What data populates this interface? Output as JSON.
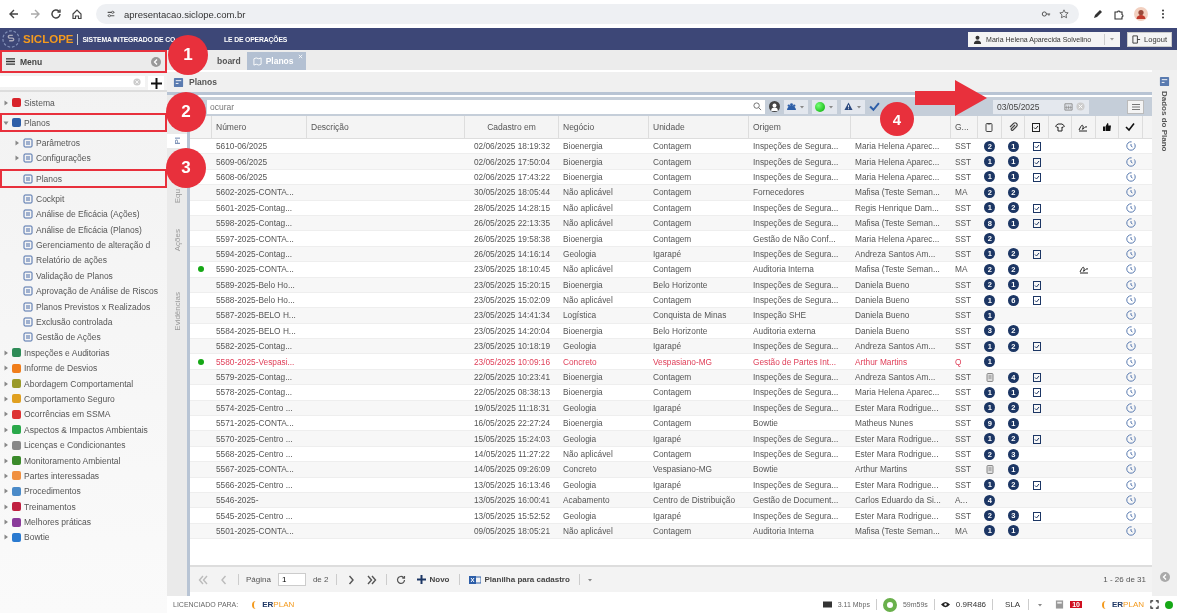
{
  "browser": {
    "url": "apresentacao.siclope.com.br"
  },
  "header": {
    "logo": "SICLOPE",
    "subtitle_a": "SISTEMA INTEGRADO DE CO",
    "subtitle_b": "LE DE OPERAÇÕES",
    "user": "Maria Helena Aparecida Solvelino",
    "logout": "Logout"
  },
  "menu": {
    "title": "Menu",
    "boxed": true,
    "items": [
      {
        "label": "Sistema",
        "collapsed": true,
        "boxed": false
      },
      {
        "label": "Planos",
        "collapsed": false,
        "boxed": true,
        "children": [
          {
            "label": "Parâmetros",
            "collapsed": true,
            "boxed": false
          },
          {
            "label": "Configurações",
            "collapsed": true,
            "boxed": false
          },
          {
            "label": "Planos",
            "boxed": true
          },
          {
            "label": "Cockpit",
            "boxed": false
          },
          {
            "label": "Análise de Eficácia (Ações)",
            "boxed": false
          },
          {
            "label": "Análise de Eficácia (Planos)",
            "boxed": false
          },
          {
            "label": "Gerenciamento de alteração d",
            "boxed": false
          },
          {
            "label": "Relatório de ações",
            "boxed": false
          },
          {
            "label": "Validação de Planos",
            "boxed": false
          },
          {
            "label": "Aprovação de Análise de Riscos",
            "boxed": false
          },
          {
            "label": "Planos Previstos x Realizados",
            "boxed": false
          },
          {
            "label": "Exclusão controlada",
            "boxed": false
          },
          {
            "label": "Gestão de Ações",
            "boxed": false
          }
        ]
      },
      {
        "label": "Inspeções e Auditorias",
        "collapsed": true,
        "boxed": false
      },
      {
        "label": "Informe de Desvios",
        "collapsed": true,
        "boxed": false
      },
      {
        "label": "Abordagem Comportamental",
        "collapsed": true,
        "boxed": false
      },
      {
        "label": "Comportamento Seguro",
        "collapsed": true,
        "boxed": false
      },
      {
        "label": "Ocorrências em SSMA",
        "collapsed": true,
        "boxed": false
      },
      {
        "label": "Aspectos & Impactos Ambientais",
        "collapsed": true,
        "boxed": false
      },
      {
        "label": "Licenças e Condicionantes",
        "collapsed": true,
        "boxed": false
      },
      {
        "label": "Monitoramento Ambiental",
        "collapsed": true,
        "boxed": false
      },
      {
        "label": "Partes interessadas",
        "collapsed": true,
        "boxed": false
      },
      {
        "label": "Procedimentos",
        "collapsed": true,
        "boxed": false
      },
      {
        "label": "Treinamentos",
        "collapsed": true,
        "boxed": false
      },
      {
        "label": "Melhores práticas",
        "collapsed": true,
        "boxed": false
      },
      {
        "label": "Bowtie",
        "collapsed": true,
        "boxed": false
      }
    ]
  },
  "tabs": [
    {
      "label": "board",
      "selected": false
    },
    {
      "label": "Planos",
      "selected": true
    }
  ],
  "panel_title": "Planos",
  "side_tabs": [
    {
      "label": "Pl",
      "selected": true
    },
    {
      "label": "Equ",
      "selected": false
    },
    {
      "label": "Ações",
      "selected": false
    },
    {
      "label": "Evidências",
      "selected": false
    }
  ],
  "toolbar": {
    "search_placeholder": "ocurar",
    "date": "03/05/2025"
  },
  "table": {
    "columns": [
      "Número",
      "Descrição",
      "Cadastro em",
      "Negócio",
      "Unidade",
      "Origem",
      "G..."
    ],
    "rows": [
      {
        "number": "5610-06/2025",
        "date": "02/06/2025 18:19:32",
        "business": "Bioenergia",
        "unit": "Contagem",
        "origin": "Inspeções de Segura...",
        "owner": "Maria Helena Aparec...",
        "g": "SST",
        "doc": "2",
        "att": "1",
        "checklist": true,
        "signed": false,
        "status_dot": false,
        "highlight": false
      },
      {
        "number": "5609-06/2025",
        "date": "02/06/2025 17:50:04",
        "business": "Bioenergia",
        "unit": "Contagem",
        "origin": "Inspeções de Segura...",
        "owner": "Maria Helena Aparec...",
        "g": "SST",
        "doc": "1",
        "att": "1",
        "checklist": true,
        "signed": false,
        "status_dot": false,
        "highlight": false
      },
      {
        "number": "5608-06/2025",
        "date": "02/06/2025 17:43:22",
        "business": "Bioenergia",
        "unit": "Contagem",
        "origin": "Inspeções de Segura...",
        "owner": "Maria Helena Aparec...",
        "g": "SST",
        "doc": "1",
        "att": "1",
        "checklist": true,
        "signed": false,
        "status_dot": false,
        "highlight": false
      },
      {
        "number": "5602-2025-CONTA...",
        "date": "30/05/2025 18:05:44",
        "business": "Não aplicável",
        "unit": "Contagem",
        "origin": "Fornecedores",
        "owner": "Mafisa (Teste Seman...",
        "g": "MA",
        "doc": "2",
        "att": "2",
        "checklist": false,
        "signed": false,
        "status_dot": false,
        "highlight": false
      },
      {
        "number": "5601-2025-Contag...",
        "date": "28/05/2025 14:28:15",
        "business": "Não aplicável",
        "unit": "Contagem",
        "origin": "Inspeções de Segura...",
        "owner": "Regis Henrique Dam...",
        "g": "SST",
        "doc": "1",
        "att": "2",
        "checklist": true,
        "signed": false,
        "status_dot": false,
        "highlight": false
      },
      {
        "number": "5598-2025-Contag...",
        "date": "26/05/2025 22:13:35",
        "business": "Não aplicável",
        "unit": "Contagem",
        "origin": "Inspeções de Segura...",
        "owner": "Mafisa (Teste Seman...",
        "g": "SST",
        "doc": "8",
        "att": "1",
        "checklist": true,
        "signed": false,
        "status_dot": false,
        "highlight": false
      },
      {
        "number": "5597-2025-CONTA...",
        "date": "26/05/2025 19:58:38",
        "business": "Bioenergia",
        "unit": "Contagem",
        "origin": "Gestão de Não Conf...",
        "owner": "Maria Helena Aparec...",
        "g": "SST",
        "doc": "2",
        "checklist": false,
        "signed": false,
        "status_dot": false,
        "highlight": false
      },
      {
        "number": "5594-2025-Contag...",
        "date": "26/05/2025 14:16:14",
        "business": "Geologia",
        "unit": "Igarapé",
        "origin": "Inspeções de Segura...",
        "owner": "Andreza Santos Am...",
        "g": "SST",
        "doc": "1",
        "att": "2",
        "checklist": true,
        "signed": false,
        "status_dot": false,
        "highlight": false
      },
      {
        "number": "5590-2025-CONTA...",
        "date": "23/05/2025 18:10:45",
        "business": "Não aplicável",
        "unit": "Contagem",
        "origin": "Auditoria Interna",
        "owner": "Mafisa (Teste Seman...",
        "g": "MA",
        "doc": "2",
        "att": "2",
        "checklist": false,
        "signed": true,
        "status_dot": true,
        "highlight": false
      },
      {
        "number": "5589-2025-Belo Ho...",
        "date": "23/05/2025 15:20:15",
        "business": "Bioenergia",
        "unit": "Belo Horizonte",
        "origin": "Inspeções de Segura...",
        "owner": "Daniela Bueno",
        "g": "SST",
        "doc": "2",
        "att": "1",
        "checklist": true,
        "signed": false,
        "status_dot": false,
        "highlight": false
      },
      {
        "number": "5588-2025-Belo Ho...",
        "date": "23/05/2025 15:02:09",
        "business": "Não aplicável",
        "unit": "Contagem",
        "origin": "Inspeções de Segura...",
        "owner": "Daniela Bueno",
        "g": "SST",
        "doc": "1",
        "att": "6",
        "checklist": true,
        "signed": false,
        "status_dot": false,
        "highlight": false
      },
      {
        "number": "5587-2025-BELO H...",
        "date": "23/05/2025 14:41:34",
        "business": "Logística",
        "unit": "Conquista de Minas",
        "origin": "Inspeção SHE",
        "owner": "Daniela Bueno",
        "g": "SST",
        "doc": "1",
        "checklist": false,
        "signed": false,
        "status_dot": false,
        "highlight": false
      },
      {
        "number": "5584-2025-BELO H...",
        "date": "23/05/2025 14:20:04",
        "business": "Bioenergia",
        "unit": "Belo Horizonte",
        "origin": "Auditoria externa",
        "owner": "Daniela Bueno",
        "g": "SST",
        "doc": "3",
        "att": "2",
        "checklist": false,
        "signed": false,
        "status_dot": false,
        "highlight": false
      },
      {
        "number": "5582-2025-Contag...",
        "date": "23/05/2025 10:18:19",
        "business": "Geologia",
        "unit": "Igarapé",
        "origin": "Inspeções de Segura...",
        "owner": "Andreza Santos Am...",
        "g": "SST",
        "doc": "1",
        "att": "2",
        "checklist": true,
        "signed": false,
        "status_dot": false,
        "highlight": false
      },
      {
        "number": "5580-2025-Vespasi...",
        "date": "23/05/2025 10:09:16",
        "business": "Concreto",
        "unit": "Vespasiano-MG",
        "origin": "Gestão de Partes Int...",
        "owner": "Arthur Martins",
        "g": "Q",
        "doc": "1",
        "checklist": false,
        "signed": false,
        "status_dot": true,
        "highlight": true
      },
      {
        "number": "5579-2025-Contag...",
        "date": "22/05/2025 10:23:41",
        "business": "Bioenergia",
        "unit": "Contagem",
        "origin": "Inspeções de Segura...",
        "owner": "Andreza Santos Am...",
        "g": "SST",
        "doc_icon": true,
        "att": "4",
        "checklist": true,
        "signed": false,
        "status_dot": false,
        "highlight": false
      },
      {
        "number": "5578-2025-Contag...",
        "date": "22/05/2025 08:38:13",
        "business": "Bioenergia",
        "unit": "Contagem",
        "origin": "Inspeções de Segura...",
        "owner": "Maria Helena Aparec...",
        "g": "SST",
        "doc": "1",
        "att": "1",
        "checklist": true,
        "signed": false,
        "status_dot": false,
        "highlight": false
      },
      {
        "number": "5574-2025-Centro ...",
        "date": "19/05/2025 11:18:31",
        "business": "Geologia",
        "unit": "Igarapé",
        "origin": "Inspeções de Segura...",
        "owner": "Ester Mara Rodrigue...",
        "g": "SST",
        "doc": "1",
        "att": "2",
        "checklist": true,
        "signed": false,
        "status_dot": false,
        "highlight": false
      },
      {
        "number": "5571-2025-CONTA...",
        "date": "16/05/2025 22:27:24",
        "business": "Bioenergia",
        "unit": "Contagem",
        "origin": "Bowtie",
        "owner": "Matheus Nunes",
        "g": "SST",
        "doc": "9",
        "att": "1",
        "checklist": false,
        "signed": false,
        "status_dot": false,
        "highlight": false
      },
      {
        "number": "5570-2025-Centro ...",
        "date": "15/05/2025 15:24:03",
        "business": "Geologia",
        "unit": "Igarapé",
        "origin": "Inspeções de Segura...",
        "owner": "Ester Mara Rodrigue...",
        "g": "SST",
        "doc": "1",
        "att": "2",
        "checklist": true,
        "signed": false,
        "status_dot": false,
        "highlight": false
      },
      {
        "number": "5568-2025-Centro ...",
        "date": "14/05/2025 11:27:22",
        "business": "Não aplicável",
        "unit": "Contagem",
        "origin": "Inspeções de Segura...",
        "owner": "Ester Mara Rodrigue...",
        "g": "SST",
        "doc": "2",
        "att": "3",
        "checklist": false,
        "signed": false,
        "status_dot": false,
        "highlight": false
      },
      {
        "number": "5567-2025-CONTA...",
        "date": "14/05/2025 09:26:09",
        "business": "Concreto",
        "unit": "Vespasiano-MG",
        "origin": "Bowtie",
        "owner": "Arthur Martins",
        "g": "SST",
        "doc_icon": true,
        "att": "1",
        "checklist": false,
        "signed": false,
        "status_dot": false,
        "highlight": false
      },
      {
        "number": "5566-2025-Centro ...",
        "date": "13/05/2025 16:13:46",
        "business": "Geologia",
        "unit": "Igarapé",
        "origin": "Inspeções de Segura...",
        "owner": "Ester Mara Rodrigue...",
        "g": "SST",
        "doc": "1",
        "att": "2",
        "checklist": true,
        "signed": false,
        "status_dot": false,
        "highlight": false
      },
      {
        "number": "5546-2025-",
        "date": "13/05/2025 16:00:41",
        "business": "Acabamento",
        "unit": "Centro de Distribuição",
        "origin": "Gestão de Document...",
        "owner": "Carlos Eduardo da Si...",
        "g": "A...",
        "doc": "4",
        "checklist": false,
        "signed": false,
        "status_dot": false,
        "highlight": false
      },
      {
        "number": "5545-2025-Centro ...",
        "date": "13/05/2025 15:52:52",
        "business": "Geologia",
        "unit": "Igarapé",
        "origin": "Inspeções de Segura...",
        "owner": "Ester Mara Rodrigue...",
        "g": "SST",
        "doc": "2",
        "att": "3",
        "checklist": true,
        "signed": false,
        "status_dot": false,
        "highlight": false
      },
      {
        "number": "5501-2025-CONTA...",
        "date": "09/05/2025 18:05:21",
        "business": "Não aplicável",
        "unit": "Contagem",
        "origin": "Auditoria Interna",
        "owner": "Mafisa (Teste Seman...",
        "g": "MA",
        "doc": "1",
        "att": "1",
        "checklist": false,
        "signed": false,
        "status_dot": false,
        "highlight": false
      }
    ]
  },
  "pager": {
    "page_label": "Página",
    "page": "1",
    "of": "de 2",
    "new": "Novo",
    "sheet": "Planilha para cadastro",
    "range": "1 - 26 de 31"
  },
  "right_panel": "Dados do Plano",
  "status": {
    "licensed": "LICENCIADO PARA:",
    "brand_left": {
      "a": "ER",
      "b": "PLAN"
    },
    "speed": "3.11 Mbps",
    "timer": "59m59s",
    "version": "0.9R486",
    "sla": "SLA",
    "alerts": "10",
    "brand_right": {
      "a": "ER",
      "b": "PLAN"
    }
  },
  "annotations": [
    {
      "kind": "step",
      "text": "1"
    },
    {
      "kind": "step",
      "text": "2"
    },
    {
      "kind": "step",
      "text": "3"
    },
    {
      "kind": "step",
      "text": "4"
    },
    {
      "kind": "arrow"
    }
  ]
}
